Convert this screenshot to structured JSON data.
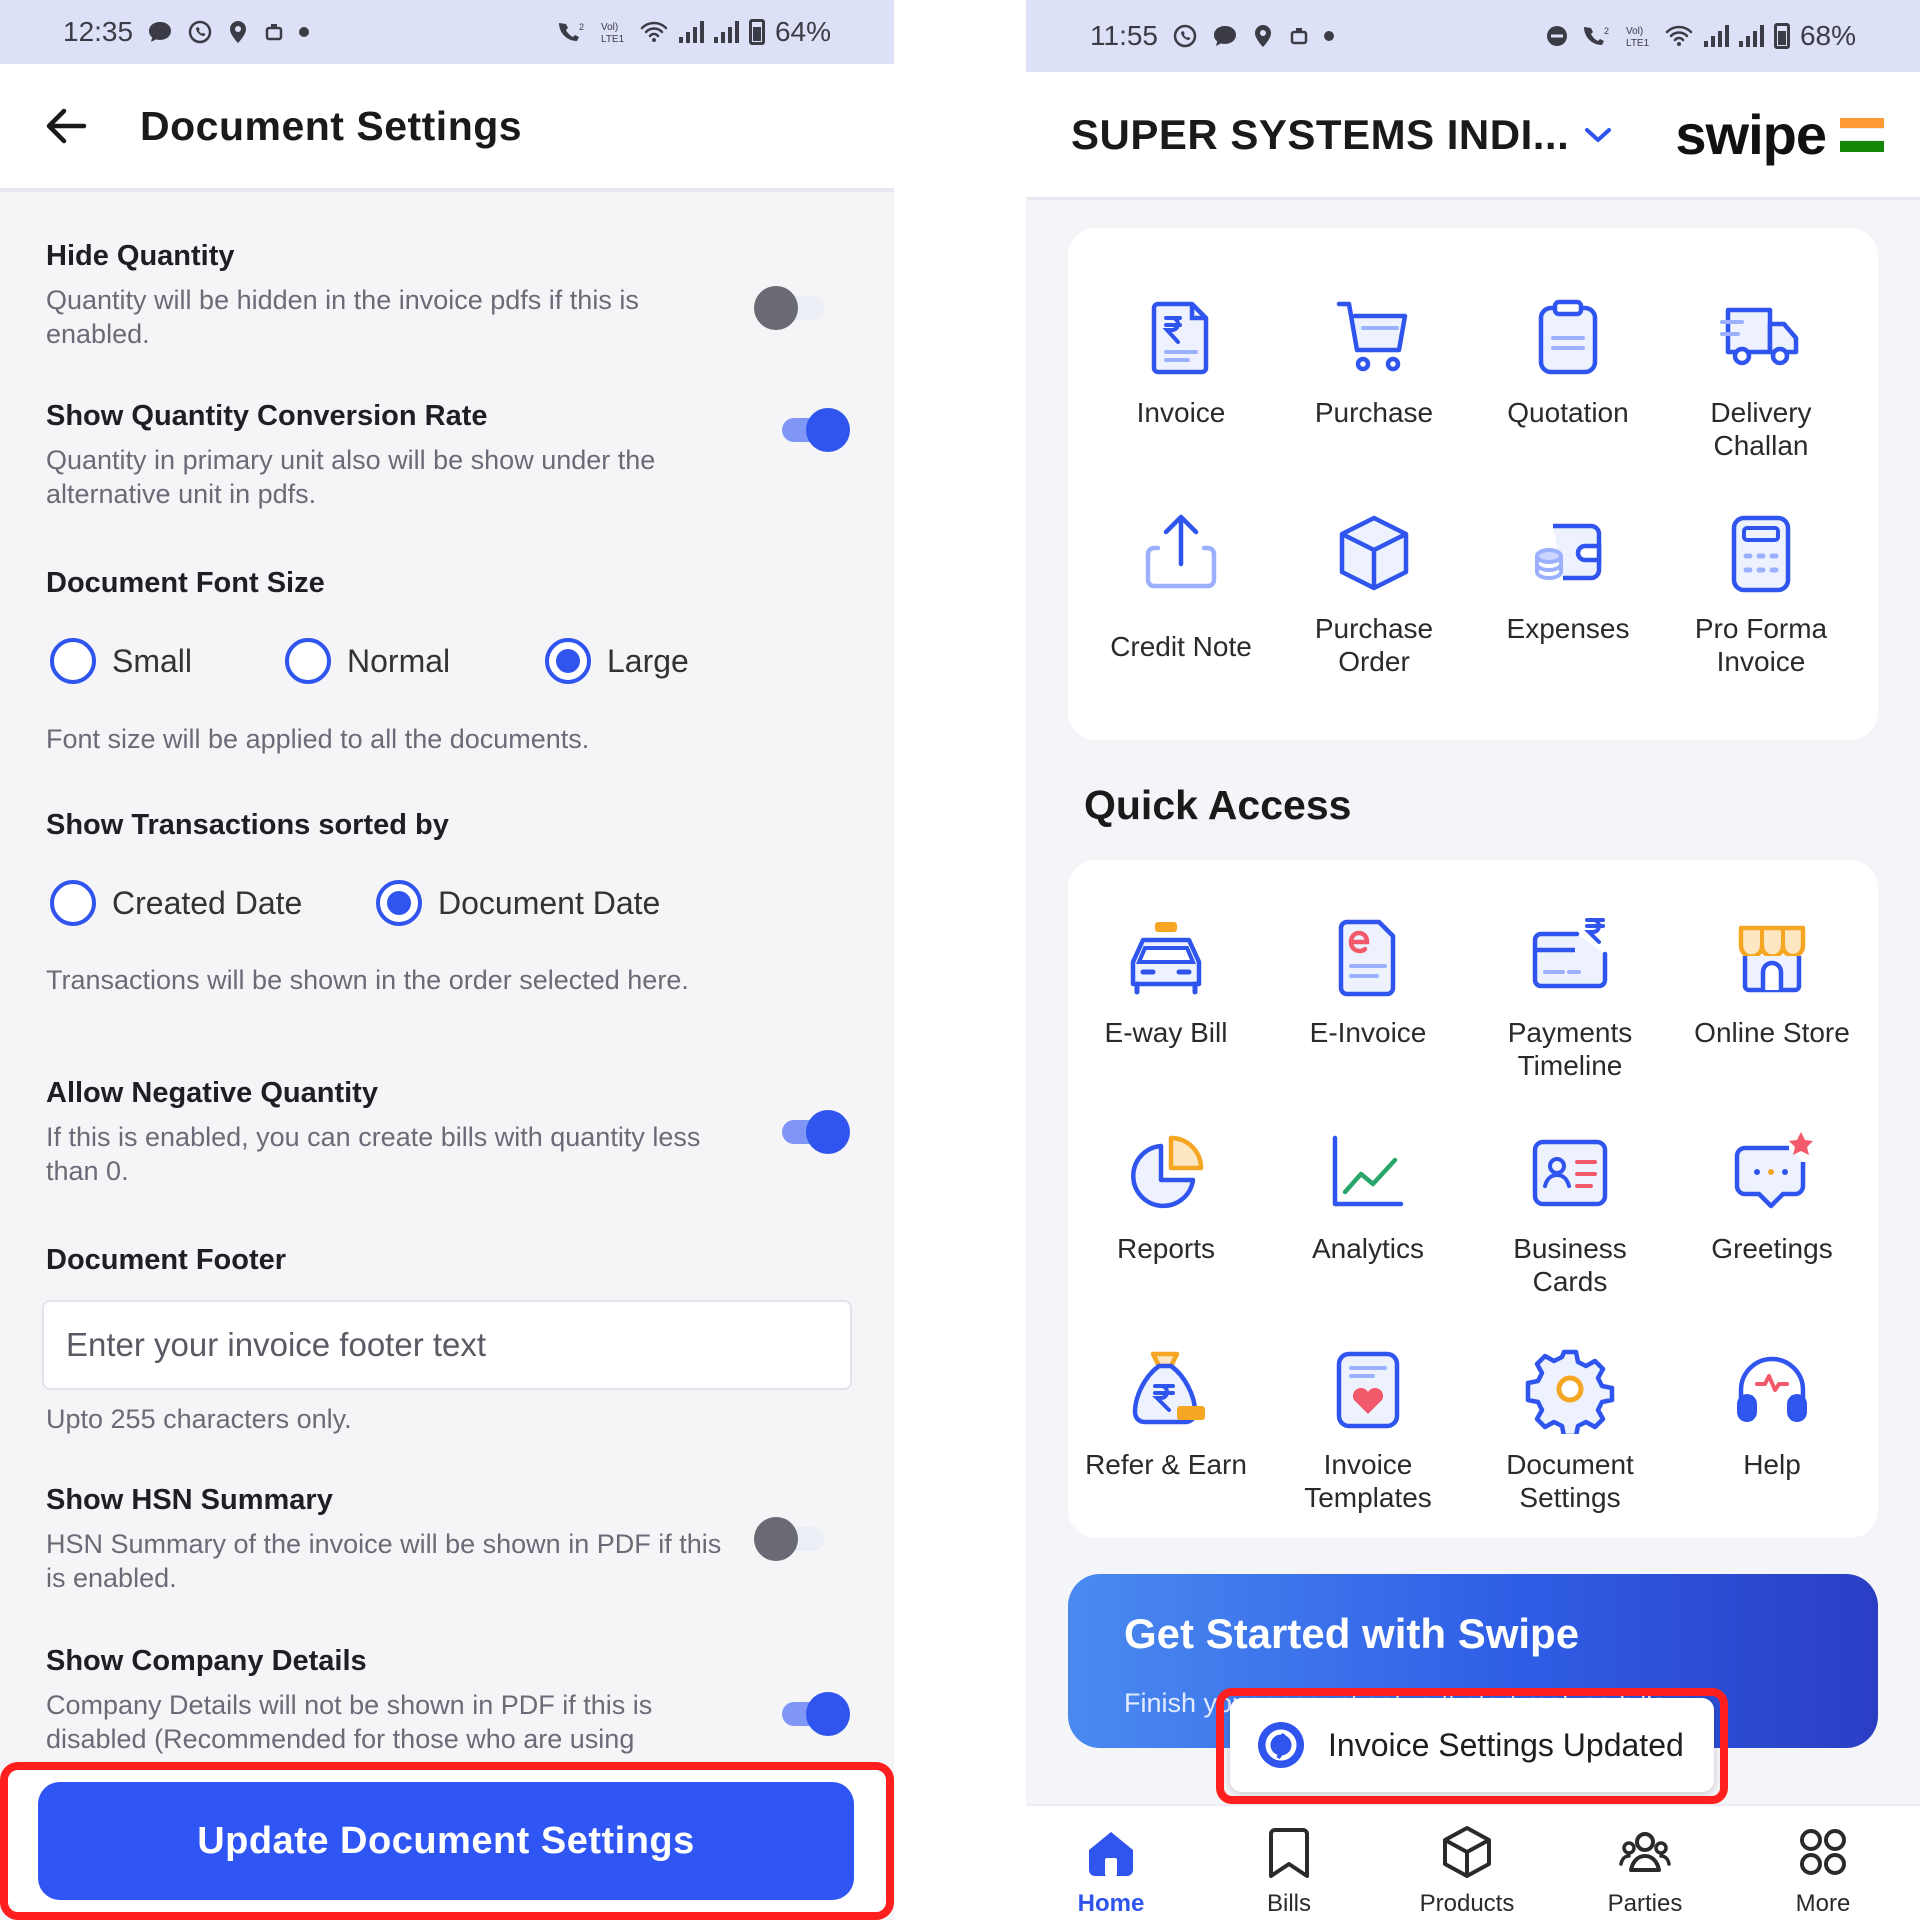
{
  "left_screen": {
    "status": {
      "time": "12:35",
      "battery": "64%"
    },
    "header": {
      "title": "Document Settings"
    },
    "settings": {
      "hide_quantity": {
        "title": "Hide Quantity",
        "desc": "Quantity will be hidden in the invoice pdfs if this is enabled.",
        "enabled": false
      },
      "conversion_rate": {
        "title": "Show Quantity Conversion Rate",
        "desc": "Quantity in primary unit also will be show under the alternative unit in pdfs.",
        "enabled": true
      },
      "font_size": {
        "title": "Document Font Size",
        "options": [
          "Small",
          "Normal",
          "Large"
        ],
        "selected": "Large",
        "hint": "Font size will be applied to all the documents."
      },
      "sort_by": {
        "title": "Show Transactions sorted by",
        "options": [
          "Created Date",
          "Document Date"
        ],
        "selected": "Document Date",
        "hint": "Transactions will be shown in the order selected here."
      },
      "negative_qty": {
        "title": "Allow Negative Quantity",
        "desc": "If this is enabled, you can create bills with quantity less than 0.",
        "enabled": true
      },
      "footer": {
        "title": "Document Footer",
        "placeholder": "Enter your invoice footer text",
        "value": "",
        "hint": "Upto 255 characters only."
      },
      "hsn_summary": {
        "title": "Show HSN Summary",
        "desc": "HSN Summary of the invoice will be shown in PDF if this is enabled.",
        "enabled": false
      },
      "company_details": {
        "title": "Show Company Details",
        "desc": "Company Details will not be shown in PDF if this is disabled (Recommended for those who are using",
        "enabled": true
      }
    },
    "update_button": "Update Document Settings"
  },
  "right_screen": {
    "status": {
      "time": "11:55",
      "battery": "68%"
    },
    "header": {
      "company": "SUPER SYSTEMS INDI...",
      "brand": "swipe"
    },
    "documents": [
      {
        "icon": "invoice-icon",
        "label": "Invoice"
      },
      {
        "icon": "purchase-cart-icon",
        "label": "Purchase"
      },
      {
        "icon": "quotation-clipboard-icon",
        "label": "Quotation"
      },
      {
        "icon": "delivery-truck-icon",
        "label": "Delivery Challan"
      },
      {
        "icon": "upload-icon",
        "label": "Credit Note"
      },
      {
        "icon": "box-icon",
        "label": "Purchase Order"
      },
      {
        "icon": "wallet-coins-icon",
        "label": "Expenses"
      },
      {
        "icon": "calculator-icon",
        "label": "Pro Forma Invoice"
      }
    ],
    "quick_access_title": "Quick Access",
    "quick_access": [
      {
        "icon": "car-icon",
        "label": "E-way Bill"
      },
      {
        "icon": "e-invoice-icon",
        "label": "E-Invoice"
      },
      {
        "icon": "payments-card-icon",
        "label": "Payments Timeline"
      },
      {
        "icon": "store-icon",
        "label": "Online Store"
      },
      {
        "icon": "pie-chart-icon",
        "label": "Reports"
      },
      {
        "icon": "line-chart-icon",
        "label": "Analytics"
      },
      {
        "icon": "id-card-icon",
        "label": "Business Cards"
      },
      {
        "icon": "chat-star-icon",
        "label": "Greetings"
      },
      {
        "icon": "money-bag-icon",
        "label": "Refer & Earn"
      },
      {
        "icon": "heart-doc-icon",
        "label": "Invoice Templates"
      },
      {
        "icon": "gear-icon",
        "label": "Document Settings"
      },
      {
        "icon": "headset-icon",
        "label": "Help"
      }
    ],
    "banner": {
      "title": "Get Started with Swipe",
      "subtitle": "Finish your account setup & start making bills."
    },
    "toast": "Invoice Settings Updated",
    "bottom_nav": [
      {
        "icon": "home-icon",
        "label": "Home",
        "active": true
      },
      {
        "icon": "bookmark-icon",
        "label": "Bills"
      },
      {
        "icon": "cube-icon",
        "label": "Products"
      },
      {
        "icon": "people-icon",
        "label": "Parties"
      },
      {
        "icon": "grid-icon",
        "label": "More"
      }
    ],
    "colors": {
      "primary": "#2f55ee",
      "highlight": "#ff1f1f",
      "red_accent": "#f25a6b",
      "orange_accent": "#f5a623"
    }
  }
}
